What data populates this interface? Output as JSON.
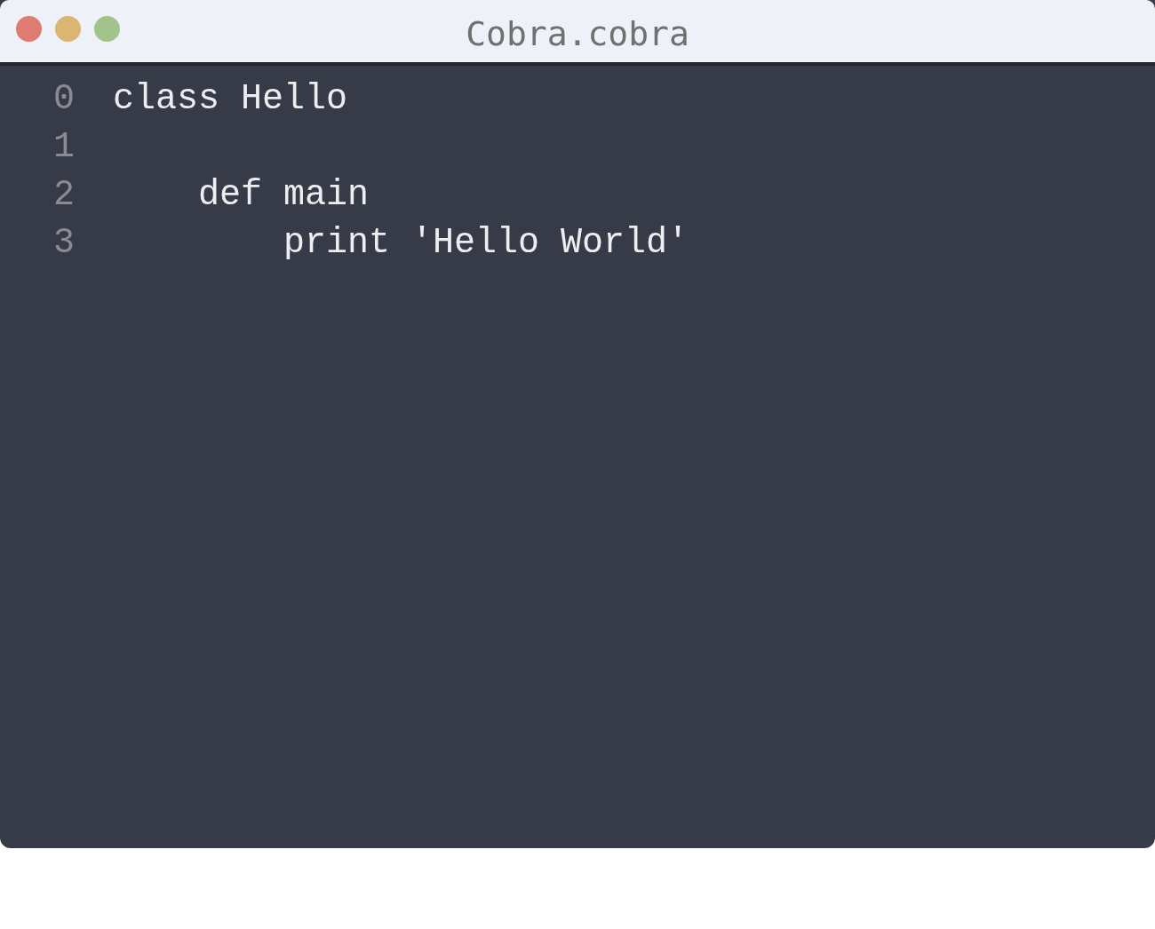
{
  "window": {
    "title": "Cobra.cobra"
  },
  "editor": {
    "lines": [
      {
        "number": "0",
        "code": "class Hello"
      },
      {
        "number": "1"
      },
      {
        "number": "2",
        "code": "    def main"
      },
      {
        "number": "3",
        "code": "        print 'Hello World'"
      }
    ]
  }
}
